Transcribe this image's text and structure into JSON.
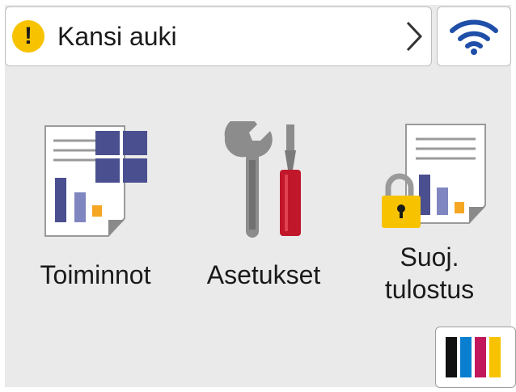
{
  "status": {
    "message": "Kansi auki",
    "warning_icon": "warning-icon",
    "warning_symbol": "!",
    "warning_color": "#f7c300"
  },
  "wifi": {
    "icon": "wifi-icon"
  },
  "tiles": [
    {
      "label": "Toiminnot",
      "icon": "functions-icon"
    },
    {
      "label": "Asetukset",
      "icon": "settings-icon"
    },
    {
      "label_line1": "Suoj.",
      "label_line2": "tulostus",
      "icon": "secure-print-icon"
    }
  ],
  "ink": {
    "icon": "ink-level-icon",
    "colors": [
      "#111111",
      "#0a7fd0",
      "#c2185b",
      "#f7c300"
    ]
  }
}
